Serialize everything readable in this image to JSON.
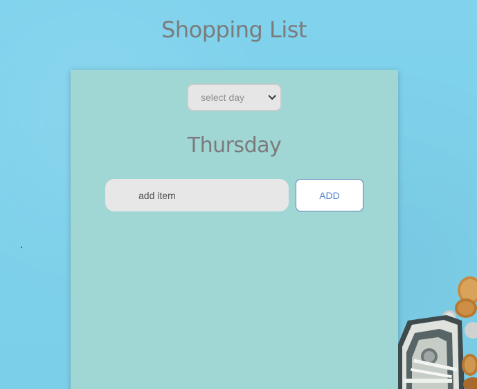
{
  "header": {
    "title": "Shopping List"
  },
  "list": {
    "day_select": {
      "selected": "select day"
    },
    "day_heading": "Thursday",
    "item_input": {
      "value": "",
      "placeholder": "add item"
    },
    "add_label": "ADD"
  },
  "colors": {
    "background": "#7fd1ec",
    "card": "#a0d6d4",
    "title_text": "#7b7b7b",
    "button_text": "#4f7fd0"
  },
  "decoration": {
    "image_icon": "coins-and-banknotes-photo"
  }
}
